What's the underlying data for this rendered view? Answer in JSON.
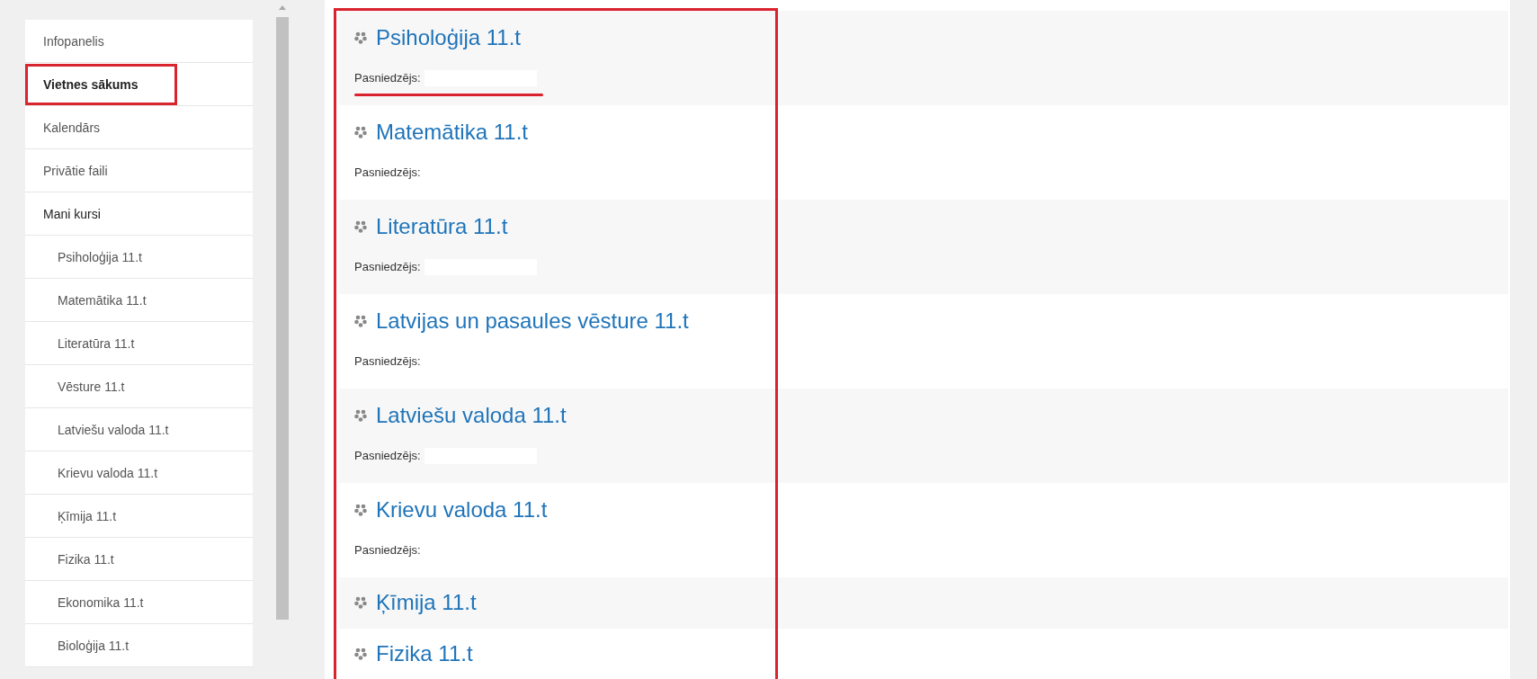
{
  "sidebar": {
    "items": [
      {
        "label": "Infopanelis",
        "selected": false,
        "highlighted": false
      },
      {
        "label": "Vietnes sākums",
        "selected": true,
        "highlighted": true
      },
      {
        "label": "Kalendārs",
        "selected": false,
        "highlighted": false
      },
      {
        "label": "Privātie faili",
        "selected": false,
        "highlighted": false
      },
      {
        "label": "Mani kursi",
        "selected": false,
        "highlighted": false,
        "children": [
          {
            "label": "Psiholoģija 11.t",
            "selected": false,
            "highlighted": false
          },
          {
            "label": "Matemātika 11.t",
            "selected": false,
            "highlighted": false
          },
          {
            "label": "Literatūra 11.t",
            "selected": false,
            "highlighted": false
          },
          {
            "label": "Vēsture 11.t",
            "selected": false,
            "highlighted": false
          },
          {
            "label": "Latviešu valoda 11.t",
            "selected": false,
            "highlighted": false
          },
          {
            "label": "Krievu valoda 11.t",
            "selected": false,
            "highlighted": false
          },
          {
            "label": "Ķīmija 11.t",
            "selected": false,
            "highlighted": false
          },
          {
            "label": "Fizika 11.t",
            "selected": false,
            "highlighted": false
          },
          {
            "label": "Ekonomika 11.t",
            "selected": false,
            "highlighted": false
          },
          {
            "label": "Bioloģija 11.t",
            "selected": false,
            "highlighted": false
          }
        ]
      }
    ]
  },
  "course_list": {
    "framed": true,
    "courses": [
      {
        "title": "Psiholoģija 11.t",
        "teacher_label": "Pasniedzējs:",
        "underlined": true
      },
      {
        "title": "Matemātika 11.t",
        "teacher_label": "Pasniedzējs:",
        "underlined": false
      },
      {
        "title": "Literatūra 11.t",
        "teacher_label": "Pasniedzējs:",
        "underlined": false
      },
      {
        "title": "Latvijas un pasaules vēsture 11.t",
        "teacher_label": "Pasniedzējs:",
        "underlined": false
      },
      {
        "title": "Latviešu valoda 11.t",
        "teacher_label": "Pasniedzējs:",
        "underlined": false
      },
      {
        "title": "Krievu valoda 11.t",
        "teacher_label": "Pasniedzējs:",
        "underlined": false
      },
      {
        "title": "Ķīmija 11.t"
      },
      {
        "title": "Fizika 11.t"
      }
    ]
  }
}
